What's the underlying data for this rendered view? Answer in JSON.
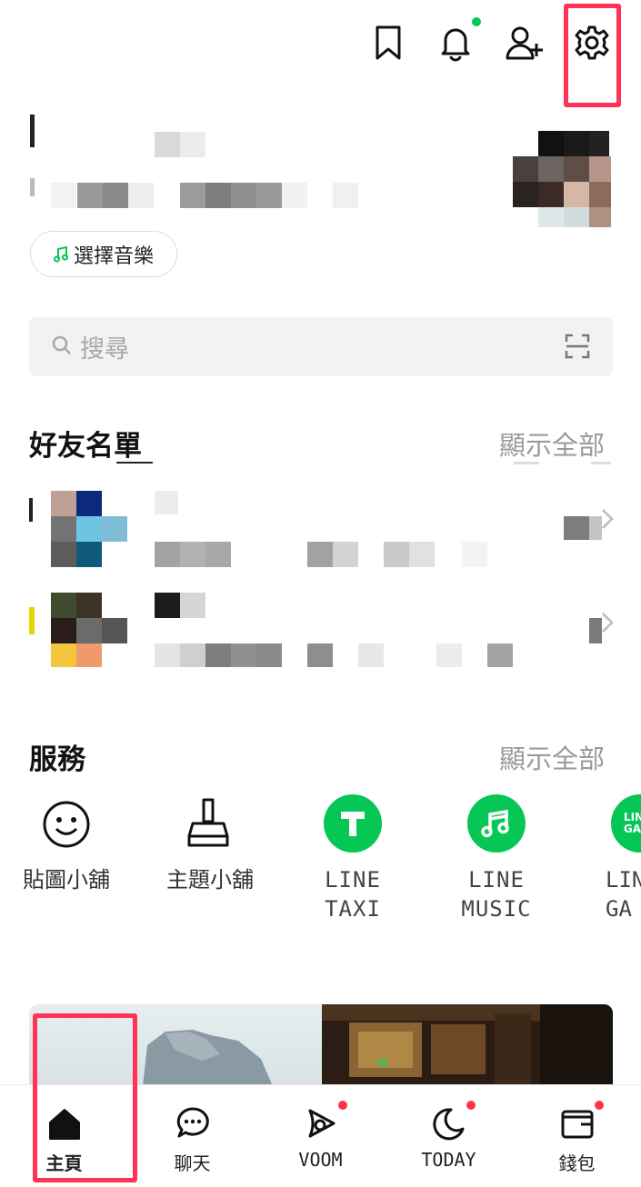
{
  "header": {
    "icons": [
      "bookmark-icon",
      "bell-icon",
      "add-friend-icon",
      "gear-icon"
    ],
    "colors": {
      "notification_dot": "#06c755",
      "highlight": "#ff3355"
    }
  },
  "profile": {
    "music_button_label": "選擇音樂"
  },
  "search": {
    "placeholder": "搜尋"
  },
  "friends": {
    "title": "好友名單",
    "show_all": "顯示全部"
  },
  "services": {
    "title": "服務",
    "show_all": "顯示全部",
    "items": [
      {
        "label_line1": "貼圖小舖",
        "label_line2": "",
        "icon": "smiley-icon"
      },
      {
        "label_line1": "主題小舖",
        "label_line2": "",
        "icon": "brush-icon"
      },
      {
        "label_line1": "LINE",
        "label_line2": "TAXI",
        "icon": "line-taxi-icon"
      },
      {
        "label_line1": "LINE",
        "label_line2": "MUSIC",
        "icon": "line-music-icon"
      },
      {
        "label_line1": "LIN",
        "label_line2": "GA",
        "icon": "line-games-icon"
      }
    ]
  },
  "tabs": [
    {
      "label": "主頁",
      "icon": "home-icon",
      "badge": false
    },
    {
      "label": "聊天",
      "icon": "chat-icon",
      "badge": false
    },
    {
      "label": "VOOM",
      "icon": "voom-icon",
      "badge": true
    },
    {
      "label": "TODAY",
      "icon": "today-icon",
      "badge": true
    },
    {
      "label": "錢包",
      "icon": "wallet-icon",
      "badge": true
    }
  ]
}
